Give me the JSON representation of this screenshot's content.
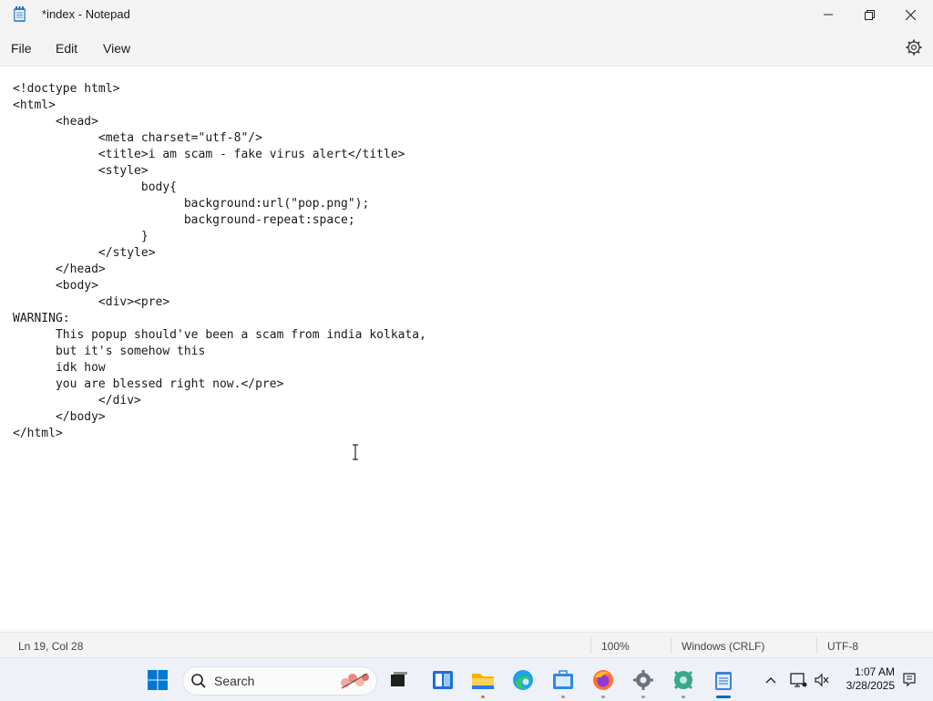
{
  "window": {
    "title": "*index - Notepad"
  },
  "menu": {
    "file": "File",
    "edit": "Edit",
    "view": "View"
  },
  "editor": {
    "content": "<!doctype html>\n<html>\n      <head>\n            <meta charset=\"utf-8\"/>\n            <title>i am scam - fake virus alert</title>\n            <style>\n                  body{\n                        background:url(\"pop.png\");\n                        background-repeat:space;\n                  }\n            </style>\n      </head>\n      <body>\n            <div><pre>\nWARNING:\n      This popup should've been a scam from india kolkata,\n      but it's somehow this\n      idk how\n      you are blessed right now.</pre>\n            </div>\n      </body>\n</html>"
  },
  "status": {
    "position": "Ln 19, Col 28",
    "zoom": "100%",
    "line_ending": "Windows (CRLF)",
    "encoding": "UTF-8"
  },
  "taskbar": {
    "search_label": "Search",
    "time": "1:07 AM",
    "date": "3/28/2025"
  },
  "colors": {
    "accent": "#0067c0",
    "titlebar_bg": "#f3f3f3",
    "editor_bg": "#ffffff",
    "taskbar_bg": "#eef1f7"
  },
  "icons": [
    "notepad-app-icon",
    "minimize-icon",
    "maximize-icon",
    "close-icon",
    "settings-gear-icon",
    "text-cursor-icon",
    "windows-start-icon",
    "search-icon",
    "task-view-icon",
    "widgets-icon",
    "file-explorer-icon",
    "edge-icon",
    "store-icon",
    "firefox-icon",
    "settings-icon",
    "app-icon",
    "notepad-taskbar-icon",
    "chevron-up-icon",
    "network-icon",
    "volume-icon",
    "notification-icon"
  ]
}
